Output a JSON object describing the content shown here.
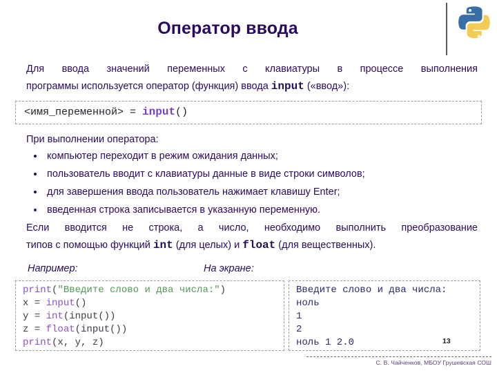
{
  "slide": {
    "title": "Оператор ввода",
    "page_number": "13",
    "footer": "С. В. Чайченков, МБОУ Грушевская СОШ",
    "logo": "python-logo",
    "title_color": "#2b0a5e"
  },
  "intro": {
    "line1": "Для ввода значений переменных с клавиатуры в процессе выполнения",
    "line2_a": "программы используется оператор (функция) ввода ",
    "line2_kw": "input",
    "line2_b": " («ввод»):"
  },
  "syntax": {
    "variable": "<имя_переменной> = ",
    "keyword": "input",
    "parens": "()"
  },
  "execution": {
    "heading": "При выполнении оператора:",
    "items": [
      "компьютер переходит в режим ожидания данных;",
      "пользователь вводит с клавиатуры данные в виде строки символов;",
      "для завершения ввода пользователь нажимает клавишу Enter;",
      "введенная строка записывается в указанную переменную."
    ]
  },
  "conversion": {
    "line1": "Если вводится не строка, а число, необходимо выполнить преобразование",
    "line2_a": "типов с помощью функций ",
    "line2_kw1": "int",
    "line2_b": " (для целых) и ",
    "line2_kw2": "float",
    "line2_c": " (для вещественных)."
  },
  "examples": {
    "code_label": "Например:",
    "output_label": "На экране:",
    "code_lines": [
      {
        "fn": "print",
        "mid": "(",
        "str": "\"Введите слово и два числа:\"",
        "tail": ")"
      },
      {
        "var": "x = ",
        "fn": "input",
        "tail": "()"
      },
      {
        "var": "y = ",
        "fn": "int",
        "tail": "(input())"
      },
      {
        "var": "z = ",
        "fn": "float",
        "tail": "(input())"
      },
      {
        "fn": "print",
        "tail": "(x, y, z)"
      }
    ],
    "output_lines": [
      "Введите слово и два числа:",
      "ноль",
      "1",
      "2",
      "ноль 1 2.0"
    ]
  },
  "colors": {
    "text": "#2b0a5e",
    "keyword_purple": "#7b3ec9",
    "code_string_green": "#4f9a4f",
    "output_navy": "#2b2b6e",
    "box_border": "#9a9a9a"
  }
}
